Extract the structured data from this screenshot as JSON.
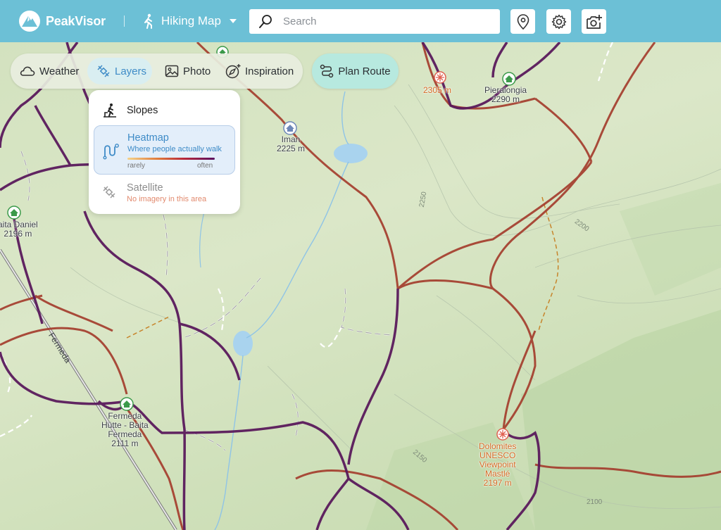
{
  "header": {
    "brand": "PeakVisor",
    "mode_label": "Hiking Map",
    "search_placeholder": "Search"
  },
  "toolbar": {
    "weather": "Weather",
    "layers": "Layers",
    "photo": "Photo",
    "inspiration": "Inspiration",
    "plan_route": "Plan Route"
  },
  "layers_panel": {
    "slopes": "Slopes",
    "heatmap": {
      "title": "Heatmap",
      "subtitle": "Where people actually walk",
      "low": "rarely",
      "high": "often"
    },
    "satellite": {
      "title": "Satellite",
      "subtitle": "No imagery in this area"
    }
  },
  "map": {
    "places": [
      {
        "name": "Pieralongia",
        "elev": "2290 m"
      },
      {
        "name": "Iman",
        "elev": "2225 m"
      },
      {
        "name": "aita Daniel",
        "elev": "2196 m"
      },
      {
        "name": "Fermeda",
        "name2": "Hütte - Baita",
        "name3": "Fermeda",
        "elev": "2111 m"
      },
      {
        "name": "Hütte"
      }
    ],
    "peak_top": "2305 m",
    "viewpoint": [
      "Dolomites",
      "UNESCO",
      "Viewpoint",
      "Mastlé",
      "2197 m"
    ],
    "road": "Fermeda",
    "contours": [
      "2250",
      "2200",
      "2150",
      "2100"
    ],
    "colors": {
      "header": "#6cc0d6",
      "trail_heat": "#5a1a5c",
      "trail_red": "#a33a2a",
      "viewpoint_label": "#d66a24"
    }
  }
}
